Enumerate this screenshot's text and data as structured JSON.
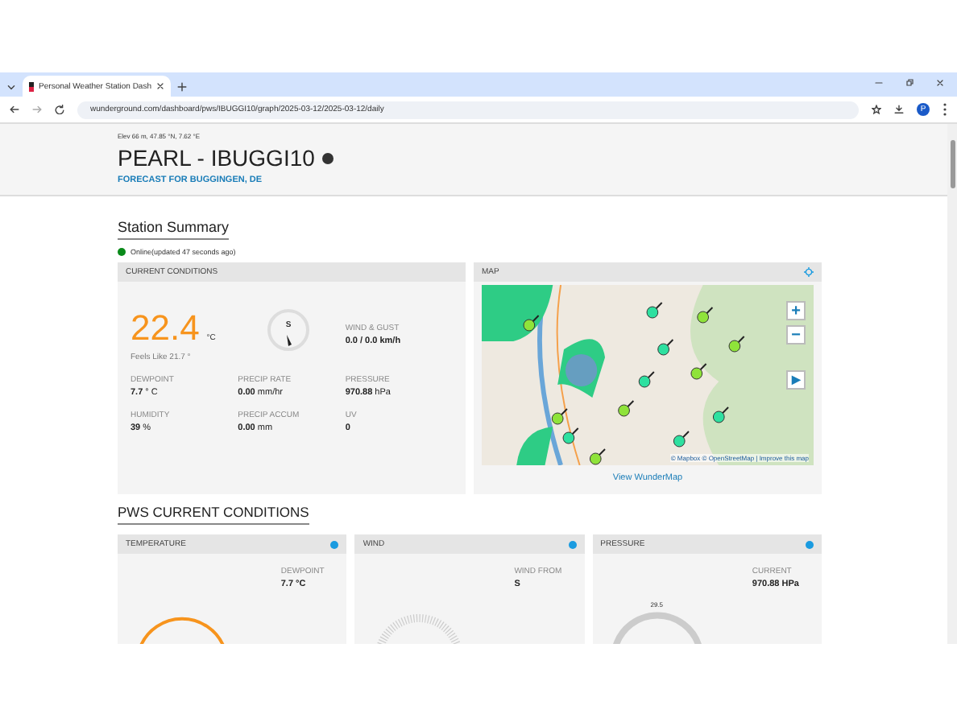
{
  "browser": {
    "tab_title": "Personal Weather Station Dash",
    "url": "wunderground.com/dashboard/pws/IBUGGI10/graph/2025-03-12/2025-03-12/daily",
    "profile_initial": "P"
  },
  "header": {
    "location": "Elev 66 m, 47.85 °N, 7.62 °E",
    "title": "PEARL - IBUGGI10",
    "forecast_link": "FORECAST FOR BUGGINGEN, DE"
  },
  "summary": {
    "title": "Station Summary",
    "status": "Online(updated 47 seconds ago)",
    "online": true
  },
  "current_conditions": {
    "title": "CURRENT CONDITIONS",
    "temperature": "22.4",
    "unit": "°C",
    "feels_like": "Feels Like 21.7 °",
    "compass_direction": "S",
    "wind_label": "WIND & GUST",
    "wind_value": "0.0 / 0.0 km/h",
    "stats": [
      {
        "label": "DEWPOINT",
        "value": "7.7",
        "unit": "° C"
      },
      {
        "label": "PRECIP RATE",
        "value": "0.00",
        "unit": "mm/hr"
      },
      {
        "label": "PRESSURE",
        "value": "970.88",
        "unit": "hPa"
      },
      {
        "label": "HUMIDITY",
        "value": "39",
        "unit": "%"
      },
      {
        "label": "PRECIP ACCUM",
        "value": "0.00",
        "unit": "mm"
      },
      {
        "label": "UV",
        "value": "0"
      }
    ]
  },
  "map": {
    "title": "MAP",
    "zoom_in": "+",
    "zoom_out": "−",
    "play": "▶",
    "attribution": "© Mapbox © OpenStreetMap | Improve this map",
    "link": "View WunderMap"
  },
  "pws_title": "PWS CURRENT CONDITIONS",
  "panels": [
    {
      "kind": "temperature",
      "title": "TEMPERATURE",
      "label": "DEWPOINT",
      "value": "7.7 °C"
    },
    {
      "kind": "wind",
      "title": "WIND",
      "label": "WIND FROM",
      "value": "S"
    },
    {
      "kind": "pressure",
      "title": "PRESSURE",
      "label": "CURRENT",
      "value": "970.88 HPa",
      "gauge_label": "29.5"
    }
  ]
}
